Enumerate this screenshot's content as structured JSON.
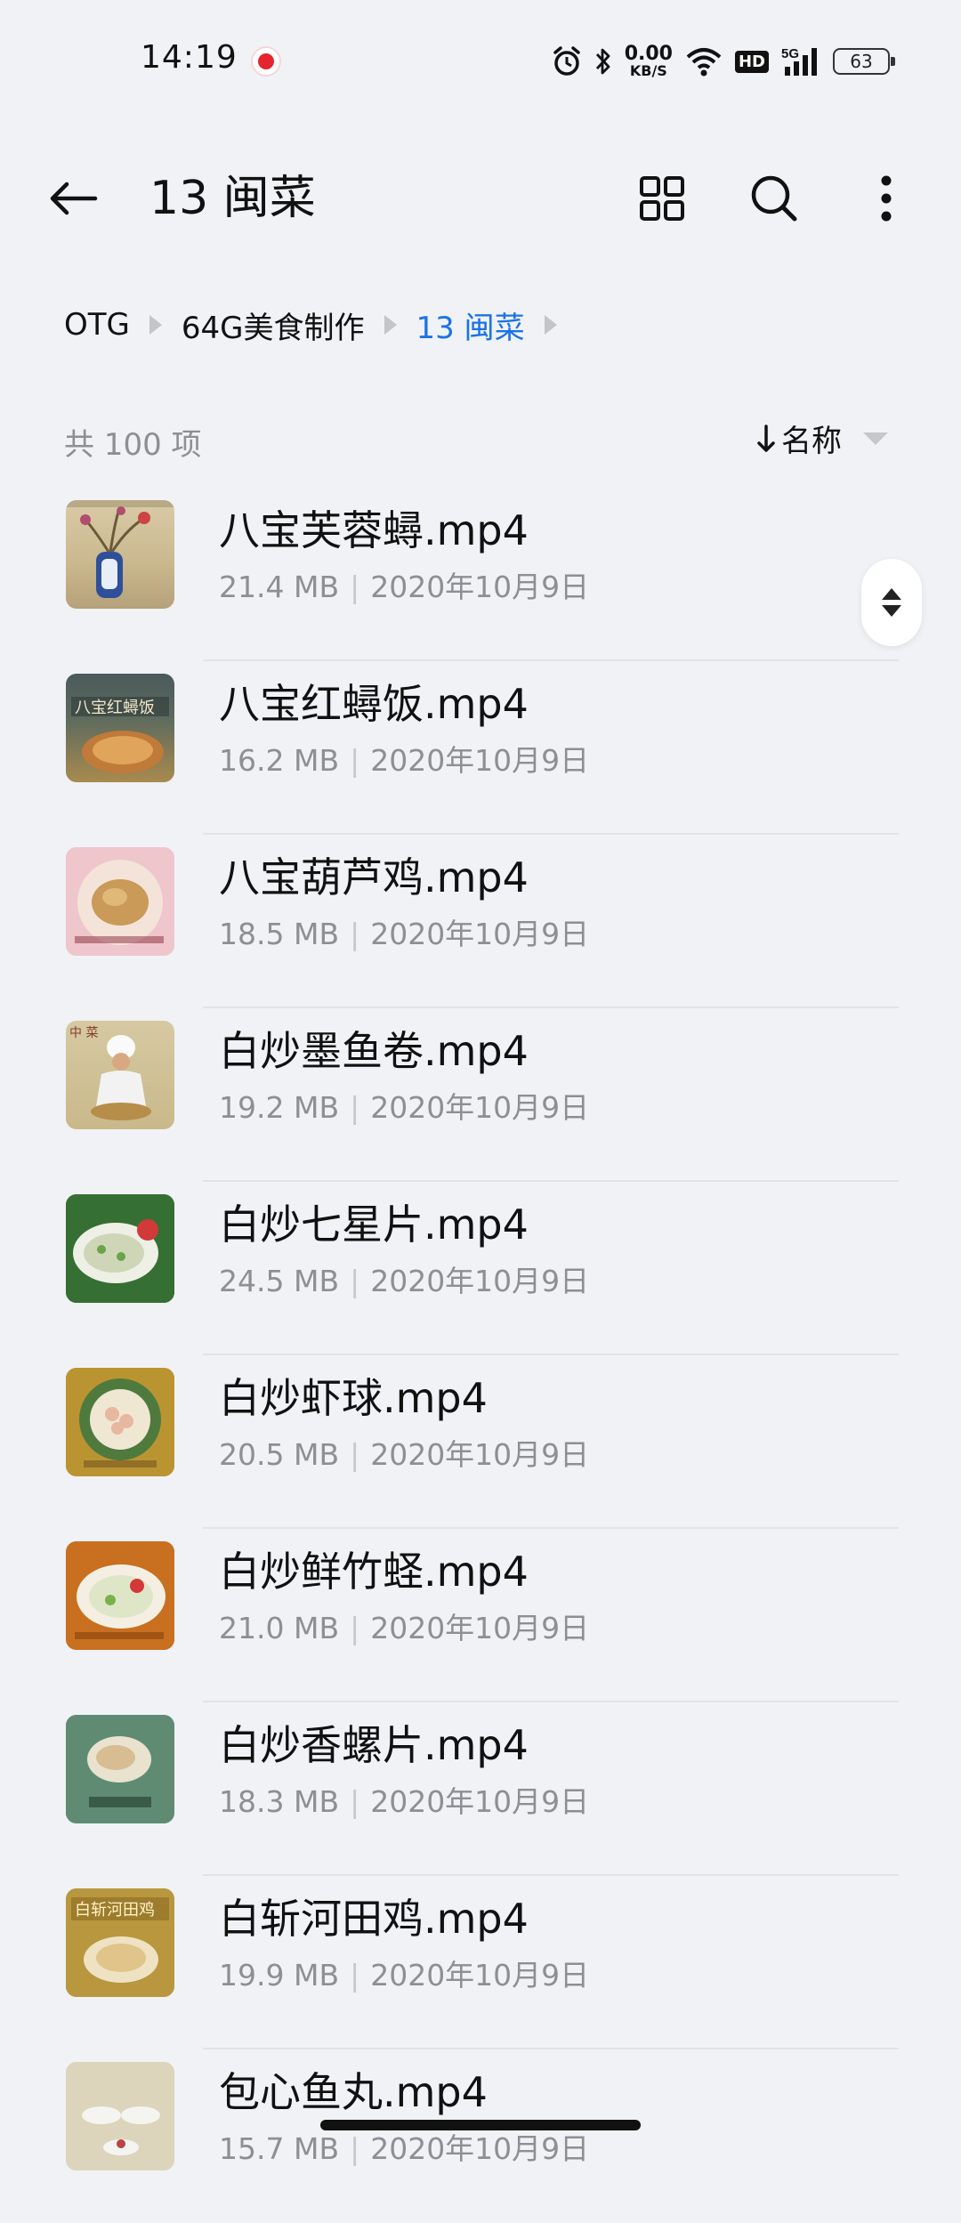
{
  "status_bar": {
    "time": "14:19",
    "net_speed_value": "0.00",
    "net_speed_unit": "KB/S",
    "hd_label": "HD",
    "network_label": "5G",
    "battery_level": "63"
  },
  "header": {
    "title": "13 闽菜"
  },
  "breadcrumb": {
    "items": [
      "OTG",
      "64G美食制作",
      "13 闽菜"
    ]
  },
  "list_header": {
    "count": "共 100 项",
    "sort_label": "名称"
  },
  "files": [
    {
      "name": "八宝芙蓉蟳.mp4",
      "size": "21.4 MB",
      "date": "2020年10月9日"
    },
    {
      "name": "八宝红蟳饭.mp4",
      "size": "16.2 MB",
      "date": "2020年10月9日"
    },
    {
      "name": "八宝葫芦鸡.mp4",
      "size": "18.5 MB",
      "date": "2020年10月9日"
    },
    {
      "name": "白炒墨鱼卷.mp4",
      "size": "19.2 MB",
      "date": "2020年10月9日"
    },
    {
      "name": "白炒七星片.mp4",
      "size": "24.5 MB",
      "date": "2020年10月9日"
    },
    {
      "name": "白炒虾球.mp4",
      "size": "20.5 MB",
      "date": "2020年10月9日"
    },
    {
      "name": "白炒鲜竹蛏.mp4",
      "size": "21.0 MB",
      "date": "2020年10月9日"
    },
    {
      "name": "白炒香螺片.mp4",
      "size": "18.3 MB",
      "date": "2020年10月9日"
    },
    {
      "name": "白斩河田鸡.mp4",
      "size": "19.9 MB",
      "date": "2020年10月9日"
    },
    {
      "name": "包心鱼丸.mp4",
      "size": "15.7 MB",
      "date": "2020年10月9日"
    }
  ],
  "colors": {
    "accent": "#1a73e8",
    "background": "#f1f2f6"
  }
}
